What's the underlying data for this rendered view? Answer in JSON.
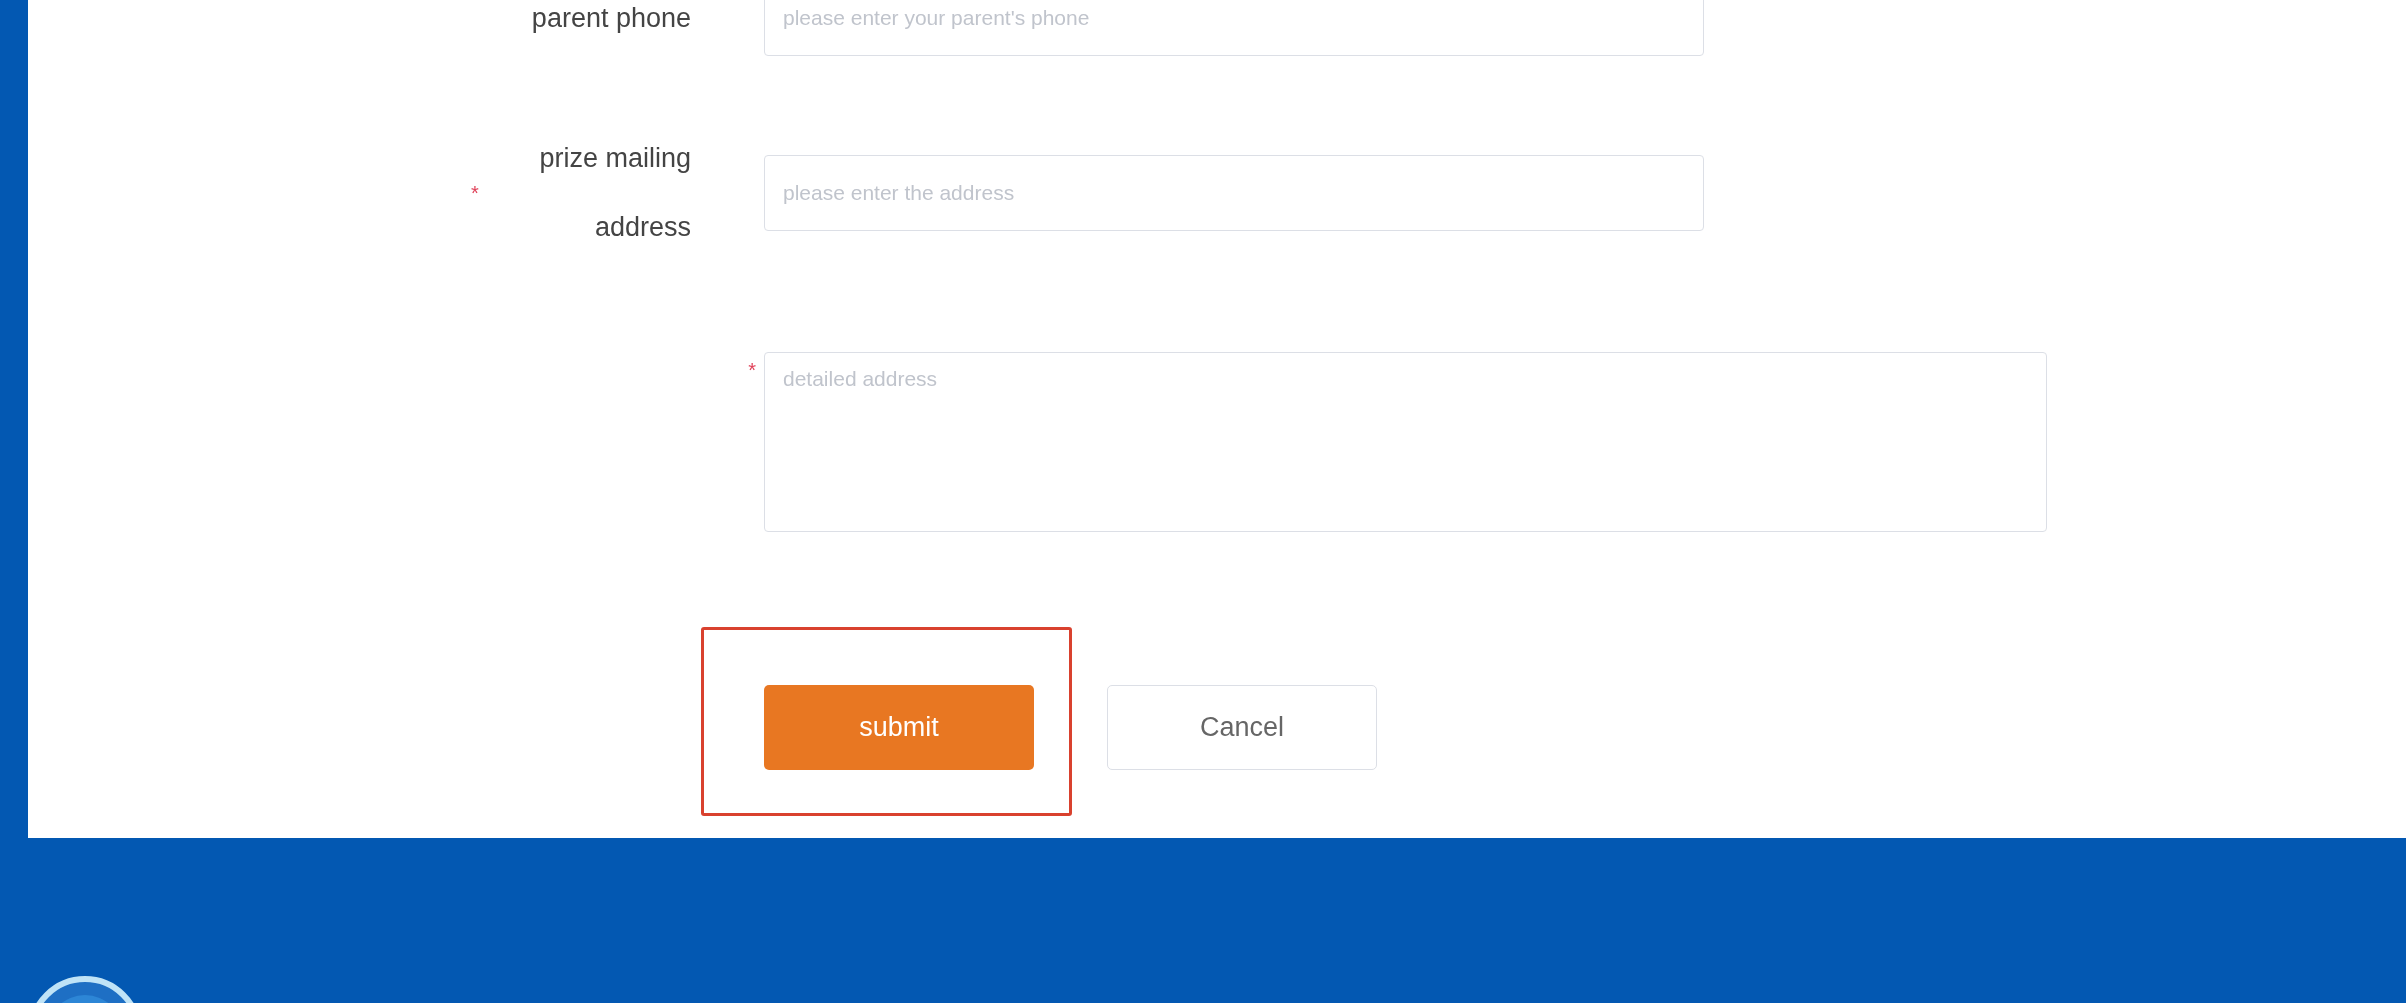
{
  "form": {
    "fields": [
      {
        "kind": "input",
        "label": "parent phone",
        "placeholder": "please enter your parent's phone"
      },
      {
        "kind": "input",
        "label": "prize mailing address",
        "required_mark": "*",
        "placeholder": "please enter the address"
      },
      {
        "kind": "textarea",
        "required_mark": "*",
        "placeholder": "detailed address"
      }
    ],
    "buttons": [
      {
        "kind": "primary",
        "label": "submit",
        "highlighted": true
      },
      {
        "kind": "secondary",
        "label": "Cancel"
      }
    ]
  }
}
